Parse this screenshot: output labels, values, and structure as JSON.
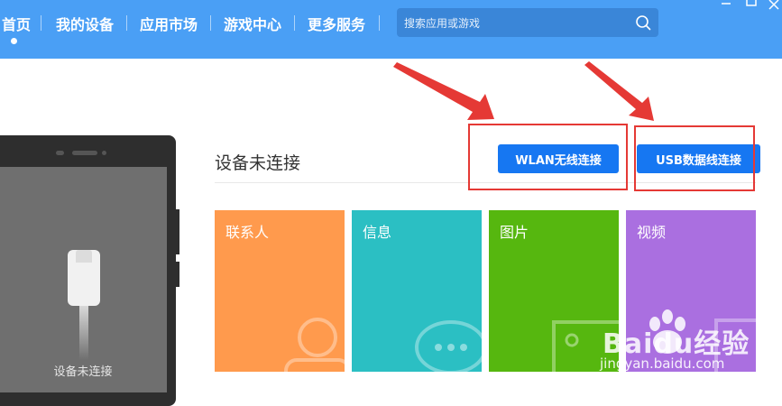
{
  "nav": {
    "items": [
      {
        "label": "首页"
      },
      {
        "label": "我的设备"
      },
      {
        "label": "应用市场"
      },
      {
        "label": "游戏中心"
      },
      {
        "label": "更多服务"
      }
    ]
  },
  "search": {
    "placeholder": "搜索应用或游戏"
  },
  "phone": {
    "status_label": "设备未连接"
  },
  "connection": {
    "title": "设备未连接",
    "wlan_button": "WLAN无线连接",
    "usb_button": "USB数据线连接"
  },
  "tiles": [
    {
      "label": "联系人",
      "color": "#ff9a4d"
    },
    {
      "label": "信息",
      "color": "#2bbfc3"
    },
    {
      "label": "图片",
      "color": "#56b70f"
    },
    {
      "label": "视频",
      "color": "#aa6fe0"
    }
  ],
  "watermark": {
    "brand": "Baidu经验",
    "url": "jingyan.baidu.com"
  },
  "colors": {
    "nav": "#4a9ff5",
    "button": "#1677f2",
    "annotation": "#e53935"
  }
}
